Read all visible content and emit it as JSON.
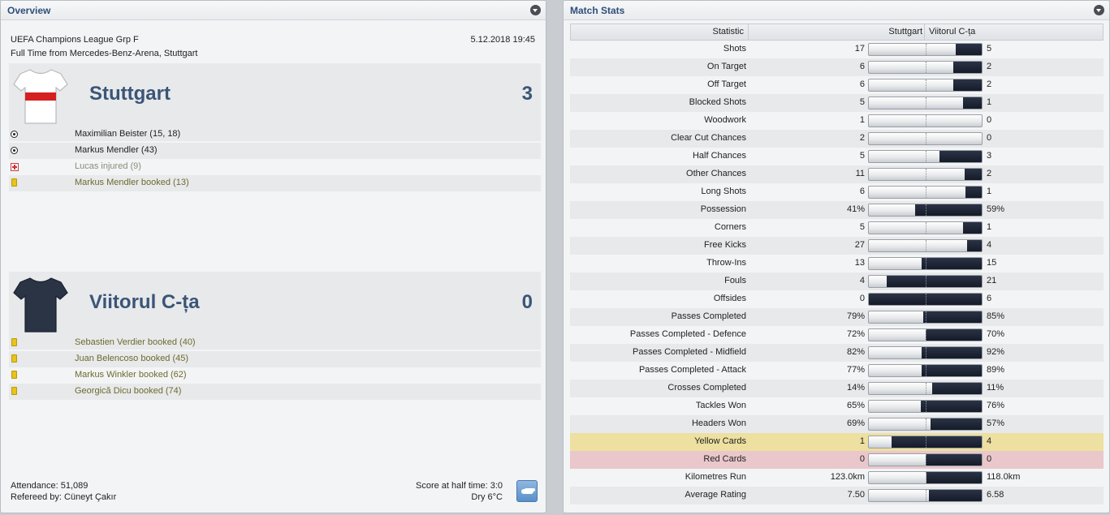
{
  "overview": {
    "title": "Overview",
    "competition": "UEFA Champions League Grp F",
    "datetime": "5.12.2018 19:45",
    "venue": "Full Time from Mercedes-Benz-Arena, Stuttgart",
    "home": {
      "name": "Stuttgart",
      "score": "3",
      "shirt_color": "#ffffff",
      "stripe_color": "#d42020"
    },
    "away": {
      "name": "Viitorul C-ța",
      "score": "0",
      "shirt_color": "#2a3444"
    },
    "home_events": [
      {
        "icon": "ball-icon",
        "text": "Maximilian Beister (15, 18)"
      },
      {
        "icon": "ball-icon",
        "text": "Markus Mendler (43)"
      },
      {
        "icon": "injury-icon",
        "text": "Lucas injured (9)"
      },
      {
        "icon": "yellow-card-icon",
        "text": "Markus Mendler booked (13)"
      }
    ],
    "away_events": [
      {
        "icon": "yellow-card-icon",
        "text": "Sebastien Verdier booked (40)"
      },
      {
        "icon": "yellow-card-icon",
        "text": "Juan Belencoso booked (45)"
      },
      {
        "icon": "yellow-card-icon",
        "text": "Markus Winkler booked (62)"
      },
      {
        "icon": "yellow-card-icon",
        "text": "Georgică Dicu booked (74)"
      }
    ],
    "attendance": "Attendance: 51,089",
    "referee": "Refereed by: Cüneyt Çakır",
    "half_time": "Score at half time: 3:0",
    "weather": "Dry 6°C",
    "weather_icon": "cloud-icon"
  },
  "stats": {
    "title": "Match Stats",
    "col_statistic": "Statistic",
    "col_home": "Stuttgart",
    "col_away": "Viitorul C-ța",
    "rows": [
      {
        "label": "Shots",
        "home": "17",
        "away": "5",
        "away_share": 0.227
      },
      {
        "label": "On Target",
        "home": "6",
        "away": "2",
        "away_share": 0.25
      },
      {
        "label": "Off Target",
        "home": "6",
        "away": "2",
        "away_share": 0.25
      },
      {
        "label": "Blocked Shots",
        "home": "5",
        "away": "1",
        "away_share": 0.167
      },
      {
        "label": "Woodwork",
        "home": "1",
        "away": "0",
        "away_share": 0
      },
      {
        "label": "Clear Cut Chances",
        "home": "2",
        "away": "0",
        "away_share": 0
      },
      {
        "label": "Half Chances",
        "home": "5",
        "away": "3",
        "away_share": 0.375
      },
      {
        "label": "Other Chances",
        "home": "11",
        "away": "2",
        "away_share": 0.154
      },
      {
        "label": "Long Shots",
        "home": "6",
        "away": "1",
        "away_share": 0.143
      },
      {
        "label": "Possession",
        "home": "41%",
        "away": "59%",
        "away_share": 0.59
      },
      {
        "label": "Corners",
        "home": "5",
        "away": "1",
        "away_share": 0.167
      },
      {
        "label": "Free Kicks",
        "home": "27",
        "away": "4",
        "away_share": 0.129
      },
      {
        "label": "Throw-Ins",
        "home": "13",
        "away": "15",
        "away_share": 0.536
      },
      {
        "label": "Fouls",
        "home": "4",
        "away": "21",
        "away_share": 0.84
      },
      {
        "label": "Offsides",
        "home": "0",
        "away": "6",
        "away_share": 1.0
      },
      {
        "label": "Passes Completed",
        "home": "79%",
        "away": "85%",
        "away_share": 0.518
      },
      {
        "label": "Passes Completed - Defence",
        "home": "72%",
        "away": "70%",
        "away_share": 0.493
      },
      {
        "label": "Passes Completed - Midfield",
        "home": "82%",
        "away": "92%",
        "away_share": 0.529
      },
      {
        "label": "Passes Completed - Attack",
        "home": "77%",
        "away": "89%",
        "away_share": 0.536
      },
      {
        "label": "Crosses Completed",
        "home": "14%",
        "away": "11%",
        "away_share": 0.44
      },
      {
        "label": "Tackles Won",
        "home": "65%",
        "away": "76%",
        "away_share": 0.539
      },
      {
        "label": "Headers Won",
        "home": "69%",
        "away": "57%",
        "away_share": 0.452
      },
      {
        "label": "Yellow Cards",
        "home": "1",
        "away": "4",
        "away_share": 0.8,
        "highlight": "yellow"
      },
      {
        "label": "Red Cards",
        "home": "0",
        "away": "0",
        "away_share": 0.5,
        "highlight": "red"
      },
      {
        "label": "Kilometres Run",
        "home": "123.0km",
        "away": "118.0km",
        "away_share": 0.49
      },
      {
        "label": "Average Rating",
        "home": "7.50",
        "away": "6.58",
        "away_share": 0.467
      }
    ]
  }
}
